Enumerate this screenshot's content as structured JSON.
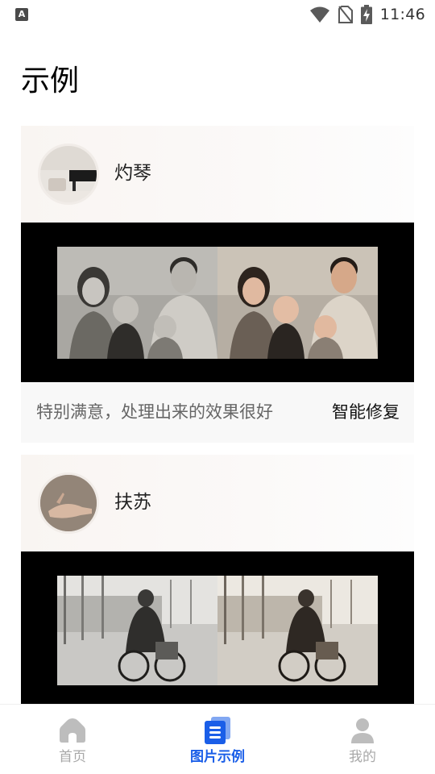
{
  "status_bar": {
    "left_icon": "A",
    "time": "11:46",
    "icons": [
      "wifi-icon",
      "no-sim-icon",
      "battery-charging-icon"
    ]
  },
  "page": {
    "title": "示例"
  },
  "examples": [
    {
      "author": "灼琴",
      "comment": "特别满意，处理出来的效果很好",
      "tag": "智能修复"
    },
    {
      "author": "扶苏"
    }
  ],
  "bottom_nav": {
    "items": [
      {
        "label": "首页",
        "icon": "home-icon",
        "active": false
      },
      {
        "label": "图片示例",
        "icon": "document-list-icon",
        "active": true
      },
      {
        "label": "我的",
        "icon": "person-icon",
        "active": false
      }
    ],
    "active_color": "#1a5ee8",
    "inactive_color": "#a8a8a8"
  }
}
